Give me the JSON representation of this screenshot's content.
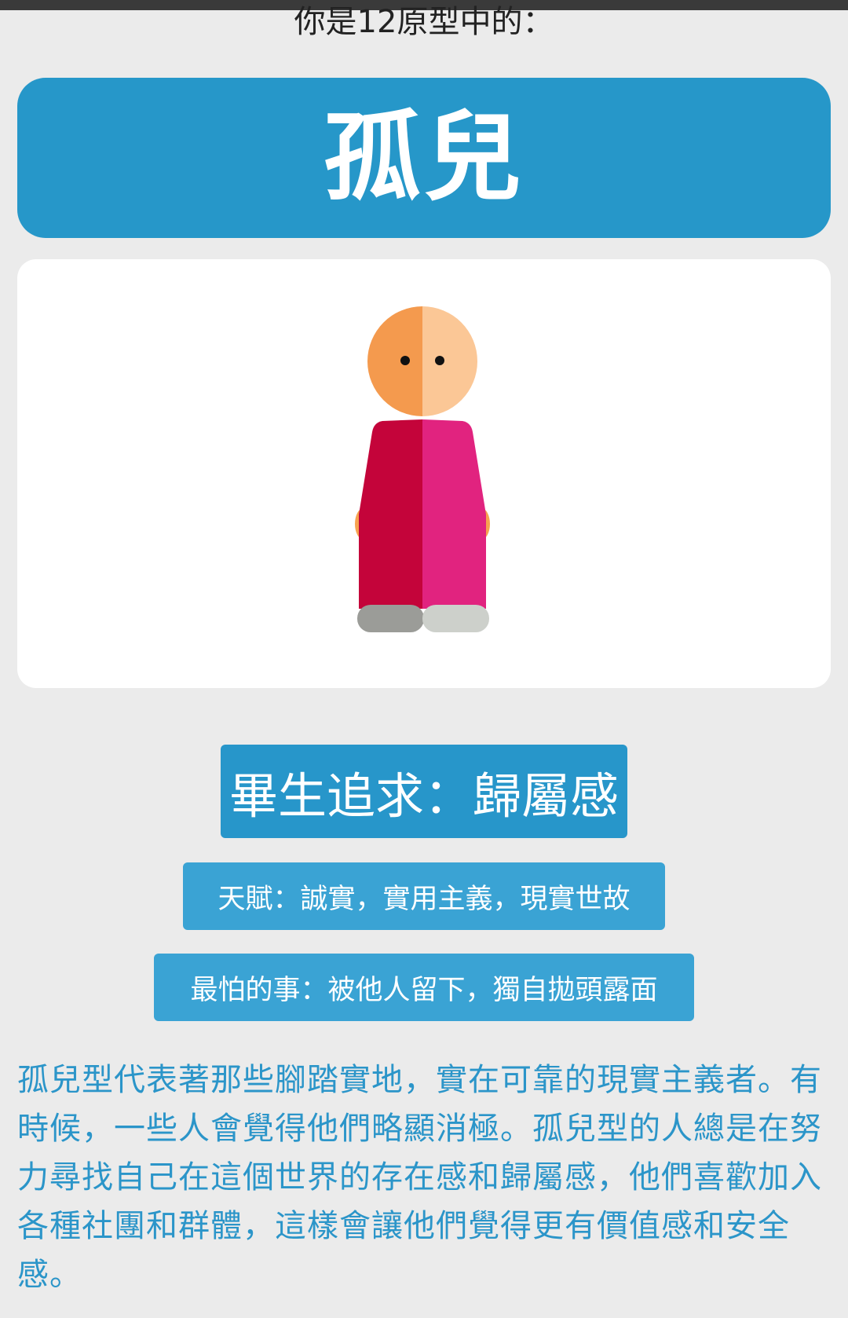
{
  "intro": "你是12原型中的：",
  "archetype": "孤兒",
  "figure": {
    "colors": {
      "head_left": "#f49a4e",
      "head_right": "#fbc796",
      "body_left": "#c4043a",
      "body_right": "#e1237f",
      "hands": "#f7a24f",
      "shoe_left": "#9b9c98",
      "shoe_right": "#cdd0cb",
      "eyes": "#111111"
    }
  },
  "lifelong_pursuit": "畢生追求：歸屬感",
  "talent": "天賦：誠實，實用主義，現實世故",
  "biggest_fear": "最怕的事：被他人留下，獨自拋頭露面",
  "description": "孤兒型代表著那些腳踏實地，實在可靠的現實主義者。有時候，一些人會覺得他們略顯消極。孤兒型的人總是在努力尋找自己在這個世界的存在感和歸屬感，他們喜歡加入各種社團和群體，這樣會讓他們覺得更有價值感和安全感。",
  "colors": {
    "background": "#ebebeb",
    "accent": "#2697c9",
    "description_text": "#2b95c9"
  }
}
